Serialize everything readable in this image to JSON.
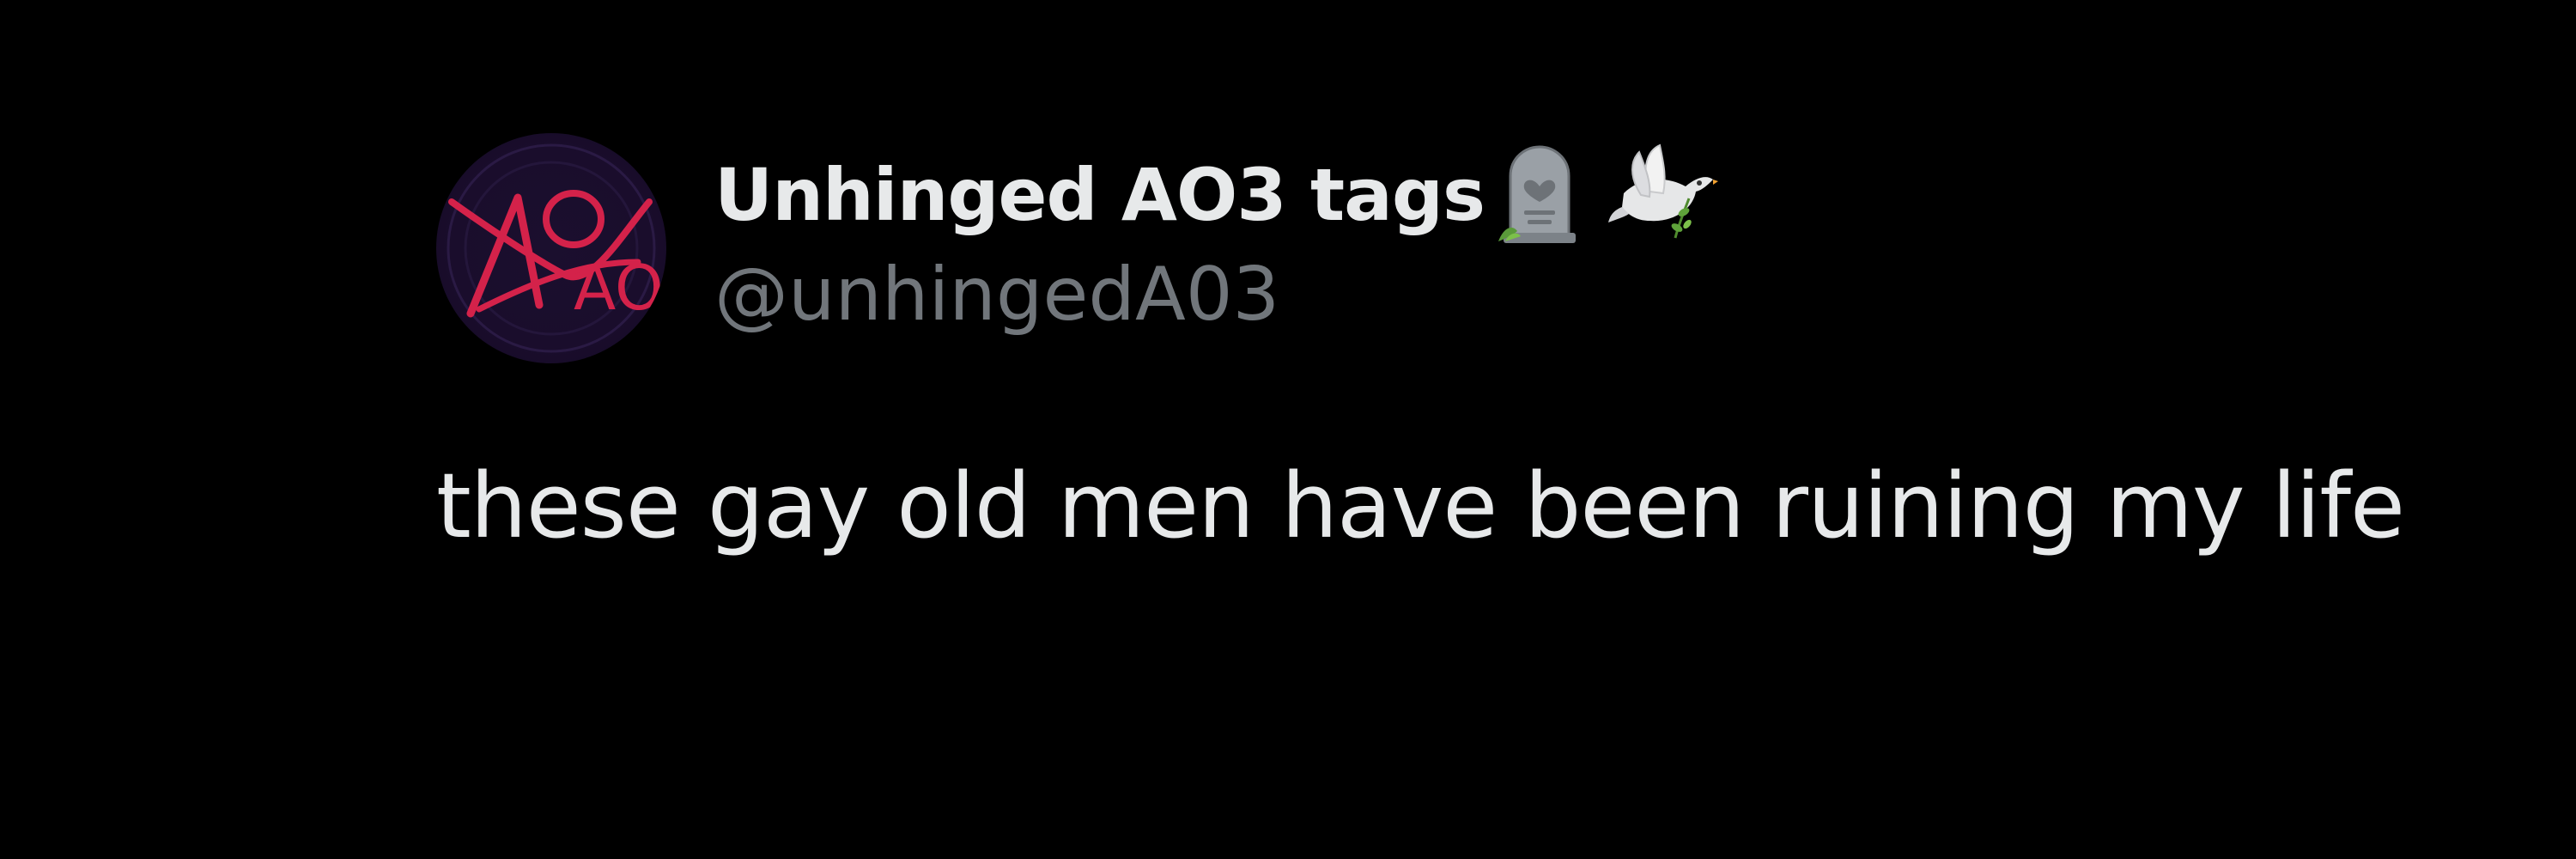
{
  "tweet": {
    "author": {
      "display_name": "Unhinged AO3 tags",
      "handle": "@unhingedA03",
      "avatar_logo_text": "AO3"
    },
    "emojis": [
      "headstone-emoji",
      "dove-emoji"
    ],
    "text": "these gay old men have been ruining my life"
  },
  "colors": {
    "background": "#000000",
    "primary_text": "#e7e9ea",
    "secondary_text": "#71767b",
    "avatar_logo": "#d4224a",
    "avatar_bg": "#1a0d2c"
  }
}
